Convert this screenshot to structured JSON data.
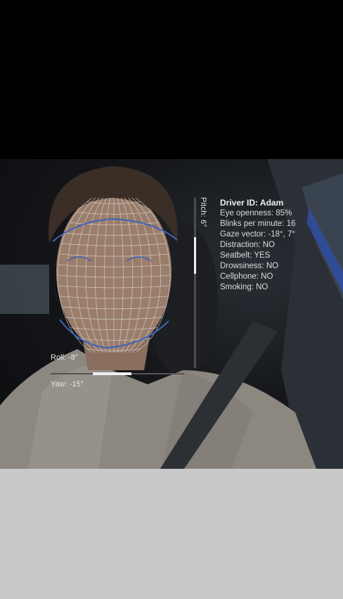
{
  "driver": {
    "title": "Driver ID: Adam",
    "metrics": [
      {
        "label": "Eye openness",
        "value": "85%",
        "text": "Eye openness: 85%"
      },
      {
        "label": "Blinks per minute",
        "value": "16",
        "text": "Blinks per minute: 16"
      },
      {
        "label": "Gaze vector",
        "value": "-18°, 7°",
        "text": "Gaze vector: -18°, 7°"
      },
      {
        "label": "Distraction",
        "value": "NO",
        "text": "Distraction: NO"
      },
      {
        "label": "Seatbelt",
        "value": "YES",
        "text": "Seatbelt: YES"
      },
      {
        "label": "Drowsiness",
        "value": "NO",
        "text": "Drowsiness: NO"
      },
      {
        "label": "Cellphone",
        "value": "NO",
        "text": "Cellphone: NO"
      },
      {
        "label": "Smoking",
        "value": "NO",
        "text": "Smoking: NO"
      }
    ]
  },
  "head_pose": {
    "pitch": {
      "label": "Pitch: 6°",
      "value_deg": 6
    },
    "roll": {
      "label": "Roll: -8°",
      "value_deg": -8
    },
    "yaw": {
      "label": "Yaw: -15°",
      "value_deg": -15
    }
  },
  "colors": {
    "mesh": "#d9d9d9",
    "contour": "#3d63b8",
    "seatbelt": "#2c2f33",
    "sweater": "#8c8880",
    "bottom_bar": "#c9c9c9"
  }
}
